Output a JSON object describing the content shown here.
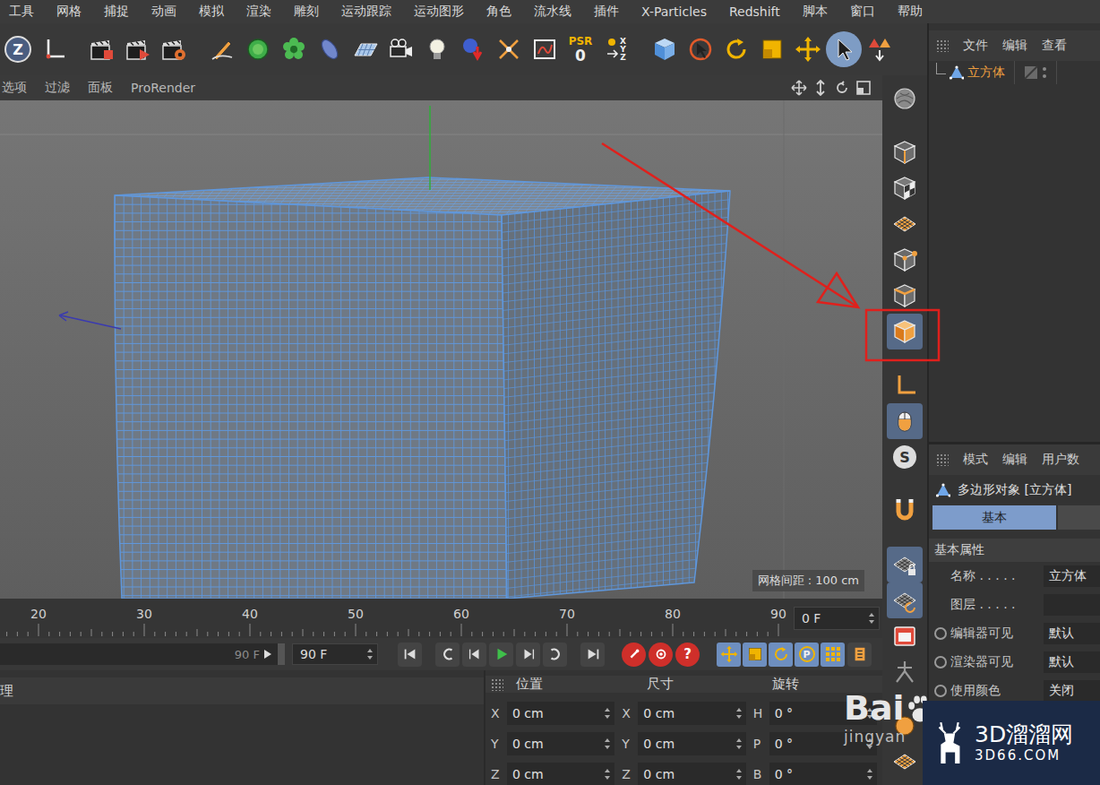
{
  "menu": [
    "工具",
    "网格",
    "捕捉",
    "动画",
    "模拟",
    "渲染",
    "雕刻",
    "运动跟踪",
    "运动图形",
    "角色",
    "流水线",
    "插件",
    "X-Particles",
    "Redshift",
    "脚本",
    "窗口",
    "帮助"
  ],
  "toolbar": [
    {
      "kind": "letter",
      "label": "Z",
      "selected": false
    },
    {
      "kind": "icon",
      "selected": false
    },
    {
      "kind": "icon",
      "selected": false
    },
    {
      "kind": "icon",
      "selected": false
    },
    {
      "kind": "icon",
      "selected": false
    },
    {
      "kind": "icon",
      "selected": false
    },
    {
      "kind": "icon",
      "selected": false
    },
    {
      "kind": "icon",
      "selected": false
    },
    {
      "kind": "icon",
      "selected": false
    },
    {
      "kind": "icon",
      "selected": false
    },
    {
      "kind": "icon",
      "selected": false
    },
    {
      "kind": "icon",
      "selected": false
    },
    {
      "kind": "icon",
      "selected": false
    },
    {
      "kind": "icon",
      "selected": false
    },
    {
      "kind": "icon",
      "selected": false
    },
    {
      "kind": "psr",
      "label": "PSR",
      "value": "0",
      "selected": false
    },
    {
      "kind": "xyz",
      "axes": [
        "X",
        "Y",
        "Z"
      ],
      "selected": false
    },
    {
      "kind": "icon",
      "selected": false
    },
    {
      "kind": "icon",
      "selected": false
    },
    {
      "kind": "icon",
      "selected": false
    },
    {
      "kind": "icon",
      "selected": false
    },
    {
      "kind": "icon",
      "selected": false
    },
    {
      "kind": "icon",
      "selected": true
    },
    {
      "kind": "icon",
      "selected": false
    }
  ],
  "viewport": {
    "menu": [
      "选项",
      "过滤",
      "面板",
      "ProRender"
    ],
    "grid_spacing": "网格间距 : 100 cm"
  },
  "vertical_tools": [
    {
      "selected": false
    },
    {
      "selected": false
    },
    {
      "selected": false
    },
    {
      "selected": false
    },
    {
      "selected": false
    },
    {
      "selected": false
    },
    {
      "selected": true
    },
    {
      "selected": false
    },
    {
      "selected": true
    },
    {
      "label": "S",
      "selected": false
    },
    {
      "selected": false
    },
    {
      "selected": true
    },
    {
      "selected": true
    },
    {
      "selected": false
    },
    {
      "selected": false
    },
    {
      "selected": false
    },
    {
      "selected": false
    }
  ],
  "object_manager": {
    "menu": [
      "文件",
      "编辑",
      "查看"
    ],
    "objects": [
      {
        "name": "立方体",
        "selected": true
      }
    ]
  },
  "attributes": {
    "menu": [
      "模式",
      "编辑",
      "用户数"
    ],
    "title": "多边形对象 [立方体]",
    "tabs": [
      {
        "label": "基本",
        "selected": true
      }
    ],
    "section": "基本属性",
    "fields": [
      {
        "kind": "text",
        "label": "名称 . . . . .",
        "value": "立方体"
      },
      {
        "kind": "text",
        "label": "图层 . . . . .",
        "value": ""
      },
      {
        "kind": "radio",
        "label": "编辑器可见",
        "value": "默认"
      },
      {
        "kind": "radio",
        "label": "渲染器可见",
        "value": "默认"
      },
      {
        "kind": "radio",
        "label": "使用颜色",
        "value": "关闭"
      }
    ]
  },
  "timeline": {
    "ticks": [
      "20",
      "30",
      "40",
      "50",
      "60",
      "70",
      "80",
      "90"
    ],
    "current": "0 F"
  },
  "playback": {
    "range_end": "90 F",
    "max": "90 F",
    "record_buttons": [
      {
        "kind": "key"
      },
      {
        "kind": "autokey"
      },
      {
        "kind": "keyset",
        "label": "?"
      }
    ],
    "key_filters": [
      {
        "selected": true
      },
      {
        "selected": true
      },
      {
        "selected": true
      },
      {
        "label": "P",
        "selected": true
      },
      {
        "selected": true
      }
    ]
  },
  "left_panel": {
    "title": "理"
  },
  "coordinates": {
    "headers": [
      "位置",
      "尺寸",
      "旋转"
    ],
    "rows": [
      {
        "axis": "X",
        "position": "0 cm",
        "size_axis": "X",
        "size": "0 cm",
        "rot_axis": "H",
        "rotation": "0 °"
      },
      {
        "axis": "Y",
        "position": "0 cm",
        "size_axis": "Y",
        "size": "0 cm",
        "rot_axis": "P",
        "rotation": "0 °"
      },
      {
        "axis": "Z",
        "position": "0 cm",
        "size_axis": "Z",
        "size": "0 cm",
        "rot_axis": "B",
        "rotation": "0 °"
      }
    ]
  },
  "watermark": {
    "baidu": "Bai",
    "jingyan": "jingyan",
    "site": "3D溜溜网",
    "url": "3D66.COM"
  }
}
